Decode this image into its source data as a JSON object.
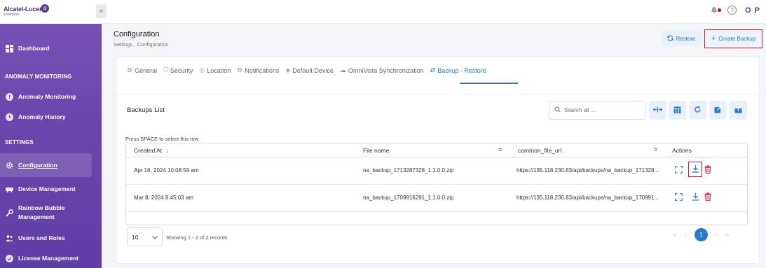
{
  "brand": {
    "name": "Alcatel-Lucent",
    "tagline": "Enterprise"
  },
  "topbar": {
    "user_initials": "O P"
  },
  "sidebar": {
    "items": [
      {
        "label": "Dashboard",
        "icon": "grid-icon"
      },
      {
        "label": "Anomaly Monitoring",
        "icon": "alert-circle-icon"
      },
      {
        "label": "Anomaly History",
        "icon": "clock-icon"
      },
      {
        "label": "Configuration",
        "icon": "gear-icon"
      },
      {
        "label": "Device Management",
        "icon": "device-icon"
      },
      {
        "label": "Rainbow Bubble Management",
        "icon": "wrench-icon"
      },
      {
        "label": "Users and Roles",
        "icon": "users-icon"
      },
      {
        "label": "License Management",
        "icon": "check-circle-icon"
      }
    ],
    "sections": {
      "anomaly": "ANOMALY MONITORING",
      "settings": "SETTINGS"
    }
  },
  "page": {
    "title": "Configuration",
    "breadcrumb": "Settings  ·  Configuration",
    "restore_label": "Restore",
    "create_backup_label": "Create Backup"
  },
  "tabs": [
    {
      "label": "General",
      "icon": "gear-icon"
    },
    {
      "label": "Security",
      "icon": "shield-icon"
    },
    {
      "label": "Location",
      "icon": "pin-icon"
    },
    {
      "label": "Notifications",
      "icon": "bell-icon"
    },
    {
      "label": "Default Device",
      "icon": "layers-icon"
    },
    {
      "label": "OmniVista Synchronization",
      "icon": "cloud-icon"
    },
    {
      "label": "Backup - Restore",
      "icon": "sync-icon",
      "active": true
    }
  ],
  "backups": {
    "title": "Backups List",
    "search_placeholder": "Search all ...",
    "hint": "Press SPACE to select this row.",
    "columns": {
      "created_at": "Created At",
      "file_name": "File name",
      "url": "common_file_url",
      "actions": "Actions"
    },
    "rows": [
      {
        "created_at": "Apr 16, 2024 10:08:59 am",
        "file_name": "na_backup_1713287328_1.1.0.0.zip",
        "url": "https://135.118.230.83/api/backups/na_backup_171328..."
      },
      {
        "created_at": "Mar 8, 2024 8:45:03 am",
        "file_name": "na_backup_1709916291_1.1.0.0.zip",
        "url": "https://135.118.230.83/api/backups/na_backup_170991..."
      }
    ],
    "page_size": "10",
    "showing": "Showing 1 - 2 of 2 records",
    "current_page": "1"
  },
  "colors": {
    "accent": "#2a78d6",
    "sidebar": "#6a48ad",
    "danger": "#d41a1a"
  }
}
